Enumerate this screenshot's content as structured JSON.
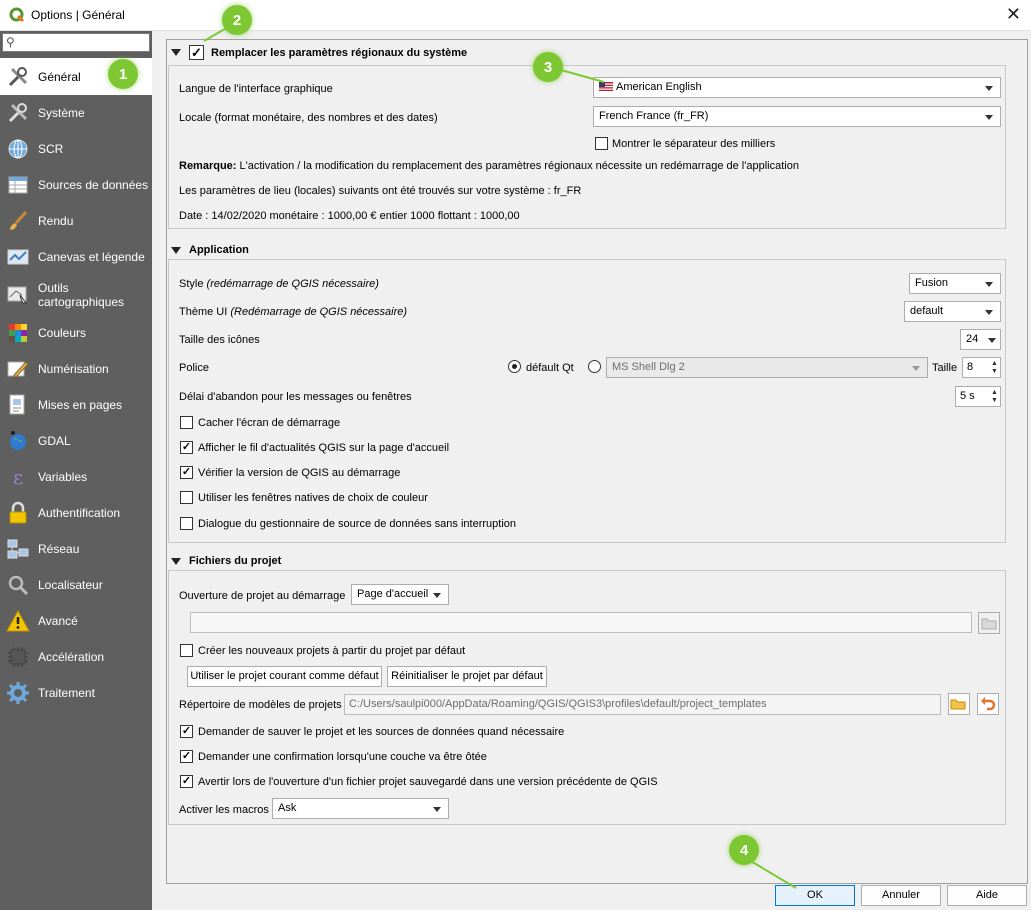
{
  "window": {
    "title": "Options | Général"
  },
  "search": {
    "placeholder": ""
  },
  "sidebar": {
    "items": [
      {
        "label": "Général",
        "icon": "general-tools-icon"
      },
      {
        "label": "Système",
        "icon": "system-tools-icon"
      },
      {
        "label": "SCR",
        "icon": "crs-globe-icon"
      },
      {
        "label": "Sources de données",
        "icon": "data-sources-table-icon"
      },
      {
        "label": "Rendu",
        "icon": "render-brush-icon"
      },
      {
        "label": "Canevas et légende",
        "icon": "canvas-legend-icon"
      },
      {
        "label": "Outils cartographiques",
        "icon": "map-tools-icon"
      },
      {
        "label": "Couleurs",
        "icon": "colors-palette-icon"
      },
      {
        "label": "Numérisation",
        "icon": "digitize-icon"
      },
      {
        "label": "Mises en pages",
        "icon": "layouts-icon"
      },
      {
        "label": "GDAL",
        "icon": "gdal-globe-icon"
      },
      {
        "label": "Variables",
        "icon": "variables-icon"
      },
      {
        "label": "Authentification",
        "icon": "lock-icon"
      },
      {
        "label": "Réseau",
        "icon": "network-icon"
      },
      {
        "label": "Localisateur",
        "icon": "locator-search-icon"
      },
      {
        "label": "Avancé",
        "icon": "warning-icon"
      },
      {
        "label": "Accélération",
        "icon": "acceleration-chip-icon"
      },
      {
        "label": "Traitement",
        "icon": "processing-gear-icon"
      }
    ]
  },
  "regional": {
    "header": "Remplacer les paramètres régionaux du système",
    "override_checked": true,
    "ui_lang_label": "Langue de l'interface graphique",
    "ui_lang_value": "American English",
    "locale_label": "Locale (format monétaire, des nombres et des dates)",
    "locale_value": "French France (fr_FR)",
    "thousands_label": "Montrer le séparateur des milliers",
    "note_bold": "Remarque:",
    "note_text": "L'activation / la modification du remplacement des paramètres régionaux nécessite un redémarrage de l'application",
    "found_text": "Les paramètres de lieu (locales) suivants ont été trouvés sur votre système : fr_FR",
    "sample_text": "Date : 14/02/2020 monétaire : 1000,00 € entier 1000 flottant : 1000,00"
  },
  "application": {
    "header": "Application",
    "style_label": "Style",
    "style_note": "(redémarrage de QGIS nécessaire)",
    "style_value": "Fusion",
    "theme_label": "Thème UI",
    "theme_note": "(Redémarrage de QGIS nécessaire)",
    "theme_value": "default",
    "icon_size_label": "Taille des icônes",
    "icon_size_value": "24",
    "font_label": "Police",
    "font_default_label": "défault Qt",
    "font_custom_value": "MS Shell Dlg 2",
    "font_size_label": "Taille",
    "font_size_value": "8",
    "timeout_label": "Délai d'abandon pour les messages ou fenêtres",
    "timeout_value": "5 s",
    "hide_splash_label": "Cacher l'écran de démarrage",
    "news_feed_label": "Afficher le fil d'actualités QGIS sur la page d'accueil",
    "check_version_label": "Vérifier la version de QGIS au démarrage",
    "native_color_label": "Utiliser les fenêtres natives de choix de couleur",
    "nonblocking_label": "Dialogue du gestionnaire de source de données sans interruption"
  },
  "project_files": {
    "header": "Fichiers du projet",
    "open_on_launch_label": "Ouverture de projet au démarrage",
    "open_on_launch_value": "Page d'accueil",
    "create_from_default_label": "Créer les nouveaux projets à partir du projet par défaut",
    "use_current_button": "Utiliser le projet courant comme défaut",
    "reset_default_button": "Réinitialiser le projet par défaut",
    "templates_dir_label": "Répertoire de modèles de projets",
    "templates_dir_value": "C:/Users/saulpi000/AppData/Roaming/QGIS/QGIS3\\profiles\\default/project_templates",
    "ask_save_label": "Demander de sauver le projet et les sources de données quand nécessaire",
    "confirm_remove_label": "Demander une confirmation lorsqu'une couche va être ôtée",
    "warn_older_label": "Avertir lors de l'ouverture d'un fichier projet sauvegardé dans une version précédente de QGIS",
    "macros_label": "Activer les macros",
    "macros_value": "Ask"
  },
  "buttons": {
    "ok": "OK",
    "cancel": "Annuler",
    "help": "Aide"
  },
  "annotations": {
    "b1": "1",
    "b2": "2",
    "b3": "3",
    "b4": "4"
  },
  "colors": {
    "sidebar": "#5f5f5f",
    "badge": "#7dc832",
    "accent": "#0078d7"
  }
}
